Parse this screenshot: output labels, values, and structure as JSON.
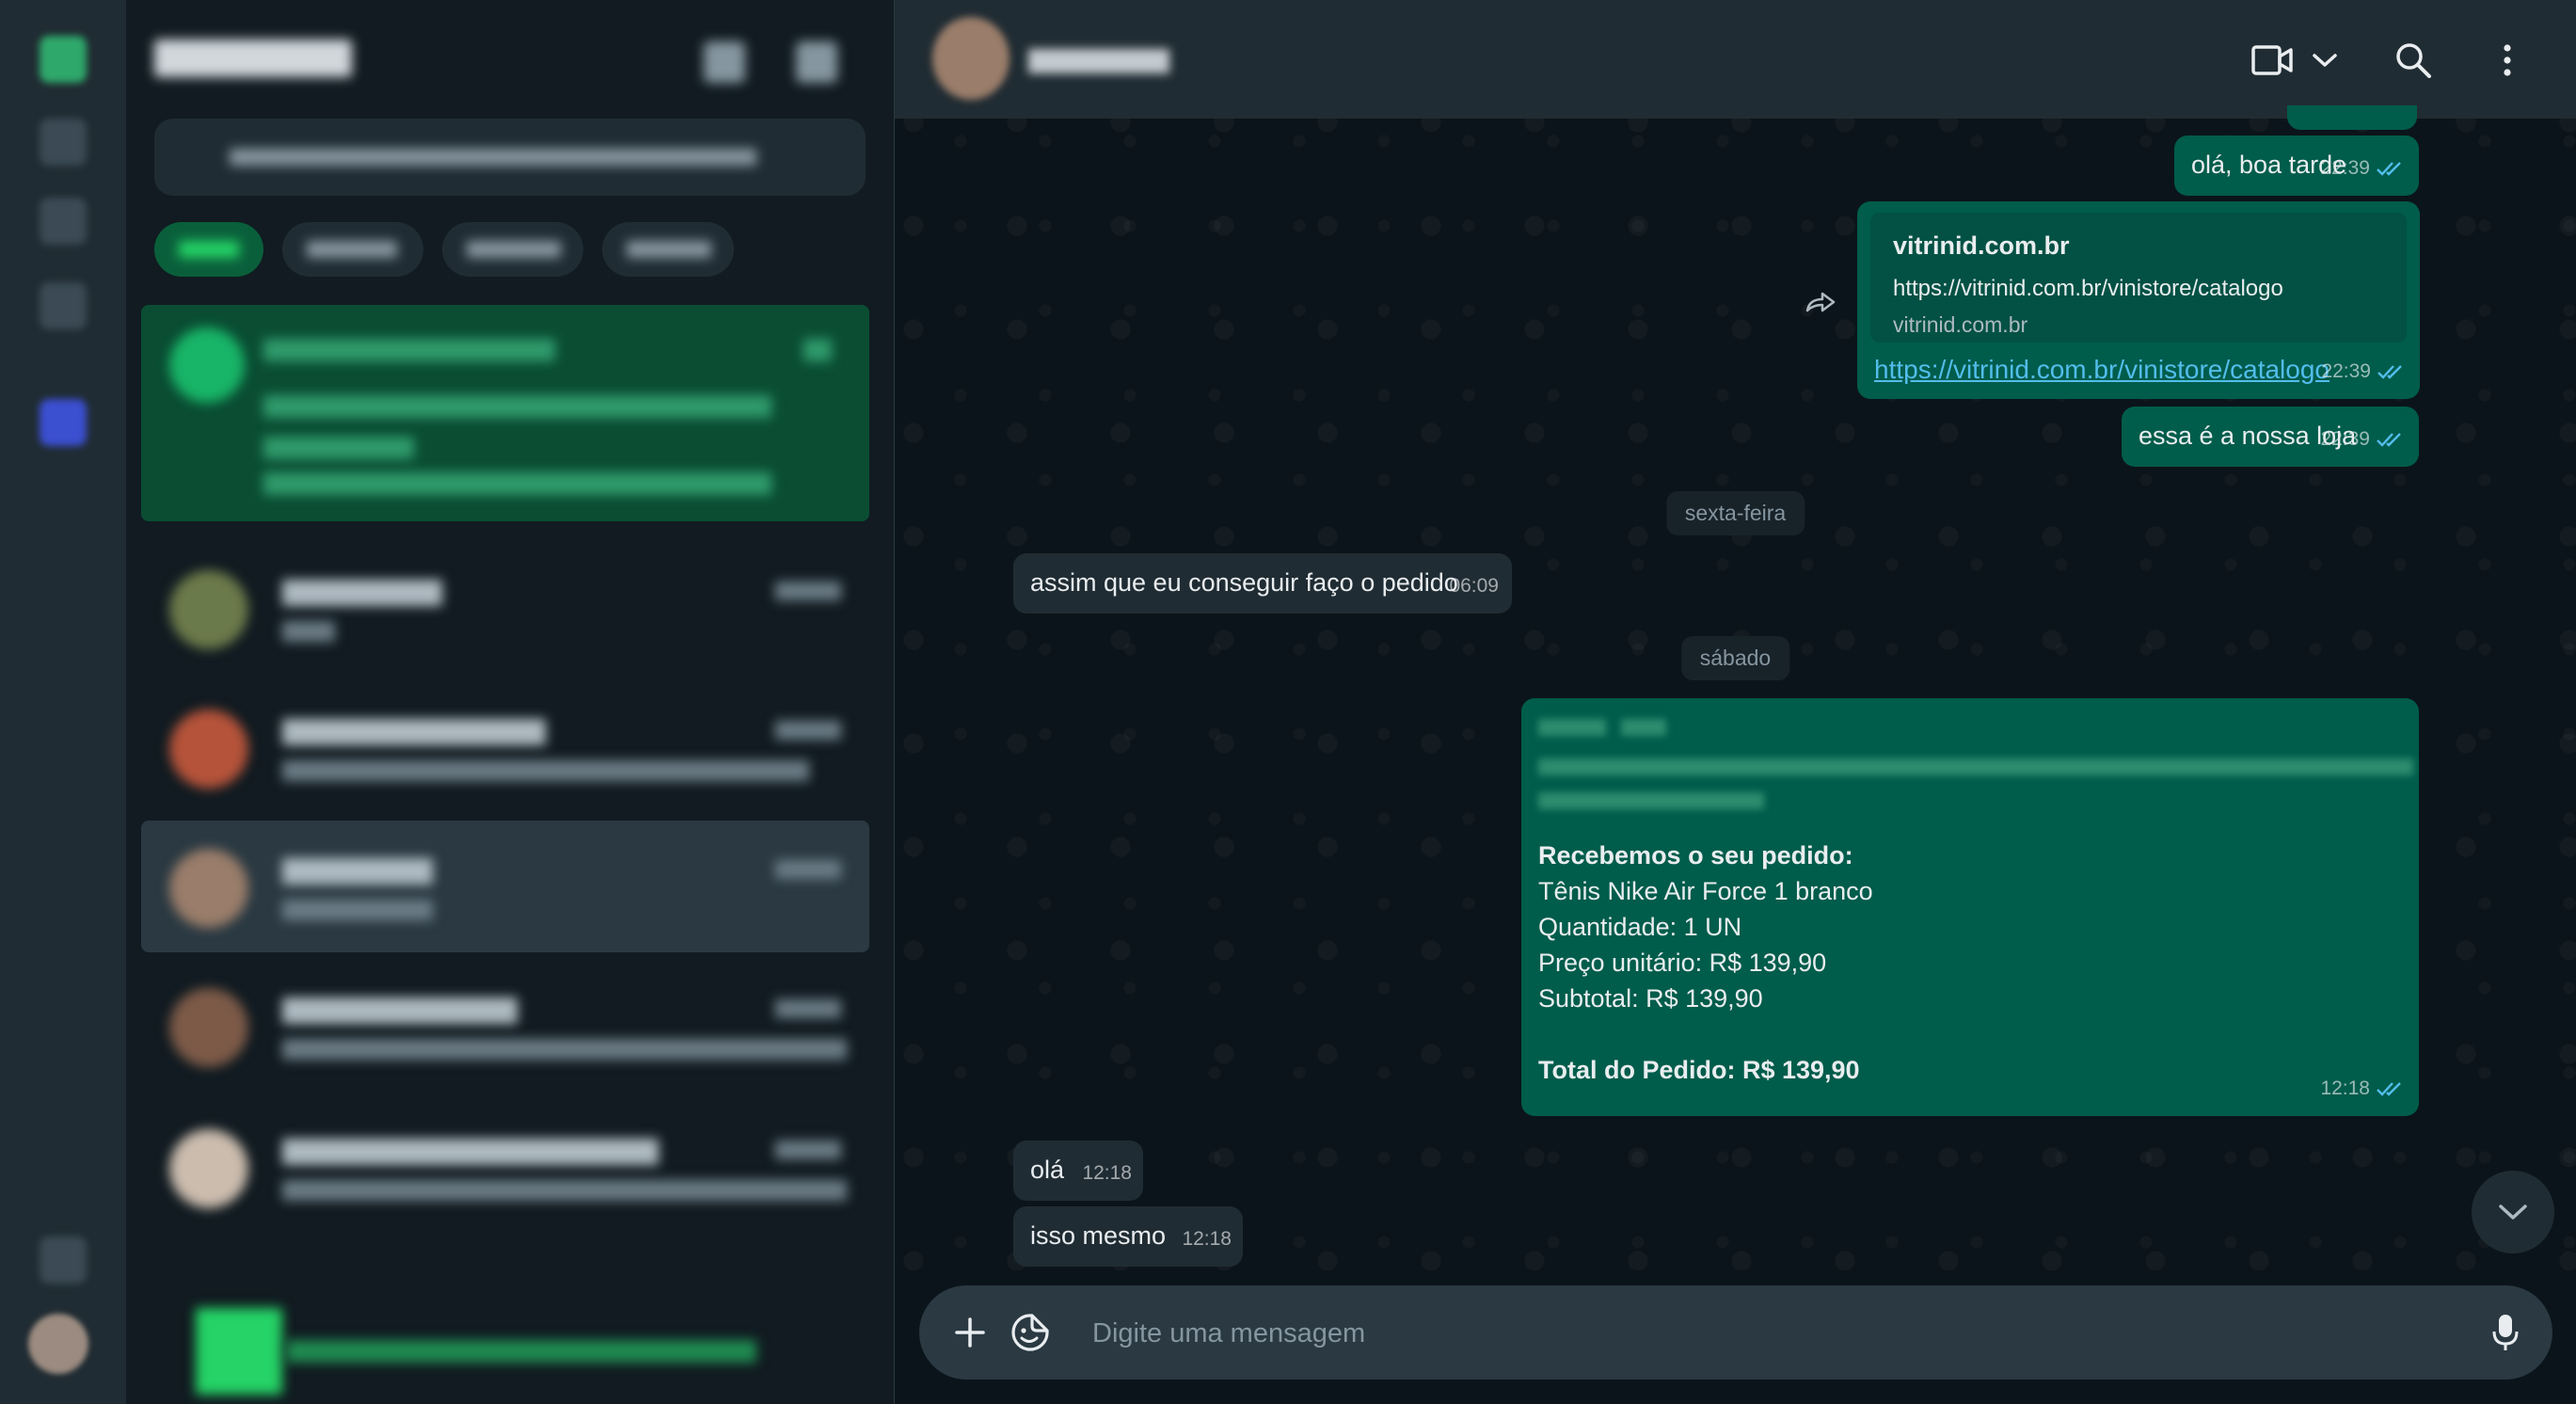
{
  "conversation": {
    "messages": {
      "m1": {
        "text": "olá, boa tarde",
        "time": "22:39"
      },
      "m2": {
        "preview_title": "vitrinid.com.br",
        "preview_url": "https://vitrinid.com.br/vinistore/catalogo",
        "preview_domain": "vitrinid.com.br",
        "link": "https://vitrinid.com.br/vinistore/catalogo",
        "time": "22:39"
      },
      "m3": {
        "text": "essa é a nossa loja",
        "time": "22:39"
      },
      "day1": "sexta-feira",
      "m4": {
        "text": "assim que eu conseguir faço o pedido",
        "time": "06:09"
      },
      "day2": "sábado",
      "m5": {
        "heading": "Recebemos o seu pedido:",
        "item": "Tênis Nike Air Force 1 branco",
        "quantity": "Quantidade: 1 UN",
        "unit_price": "Preço unitário: R$ 139,90",
        "subtotal": "Subtotal: R$ 139,90",
        "total": "Total do Pedido: R$ 139,90",
        "time": "12:18"
      },
      "m6": {
        "text": "olá",
        "time": "12:18"
      },
      "m7": {
        "text": "isso mesmo",
        "time": "12:18"
      }
    }
  },
  "composer": {
    "placeholder": "Digite uma mensagem"
  },
  "colors": {
    "accent": "#25d366",
    "outgoing_bubble": "#005c4b",
    "incoming_bubble": "#202c33",
    "read_tick": "#53bdeb"
  },
  "icons": {
    "header": [
      "video-call-icon",
      "chevron-down-icon",
      "search-icon",
      "menu-dots-icon"
    ],
    "composer": [
      "plus-icon",
      "sticker-icon",
      "mic-icon"
    ],
    "forward": "forward-icon",
    "scroll_down": "chevron-down-icon"
  }
}
